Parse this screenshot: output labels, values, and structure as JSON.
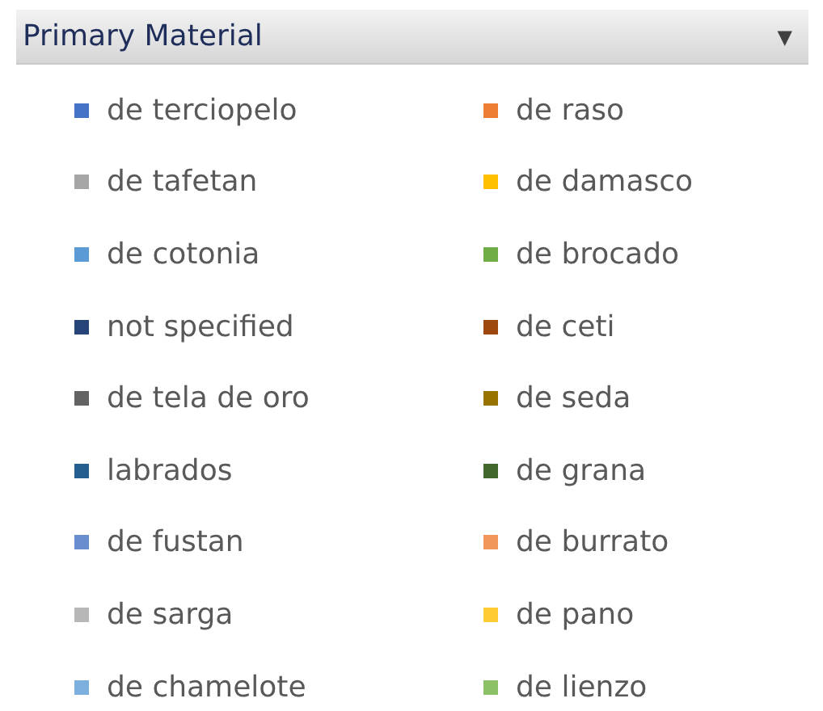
{
  "header": {
    "title": "Primary Material",
    "dropdown_icon": "▼"
  },
  "legend": [
    {
      "label": "de terciopelo",
      "color": "#4472c4"
    },
    {
      "label": "de raso",
      "color": "#ed7d31"
    },
    {
      "label": "de tafetan",
      "color": "#a5a5a5"
    },
    {
      "label": "de damasco",
      "color": "#ffc000"
    },
    {
      "label": "de cotonia",
      "color": "#5b9bd5"
    },
    {
      "label": "de brocado",
      "color": "#70ad47"
    },
    {
      "label": "not specified",
      "color": "#264478"
    },
    {
      "label": "de ceti",
      "color": "#9e480e"
    },
    {
      "label": "de tela de oro",
      "color": "#636363"
    },
    {
      "label": "de seda",
      "color": "#997300"
    },
    {
      "label": "labrados",
      "color": "#255e91"
    },
    {
      "label": "de grana",
      "color": "#43682b"
    },
    {
      "label": "de fustan",
      "color": "#698ed0"
    },
    {
      "label": "de burrato",
      "color": "#f1975a"
    },
    {
      "label": "de sarga",
      "color": "#b7b7b7"
    },
    {
      "label": "de pano",
      "color": "#ffcd33"
    },
    {
      "label": "de chamelote",
      "color": "#7cafdd"
    },
    {
      "label": "de lienzo",
      "color": "#8cc168"
    }
  ]
}
